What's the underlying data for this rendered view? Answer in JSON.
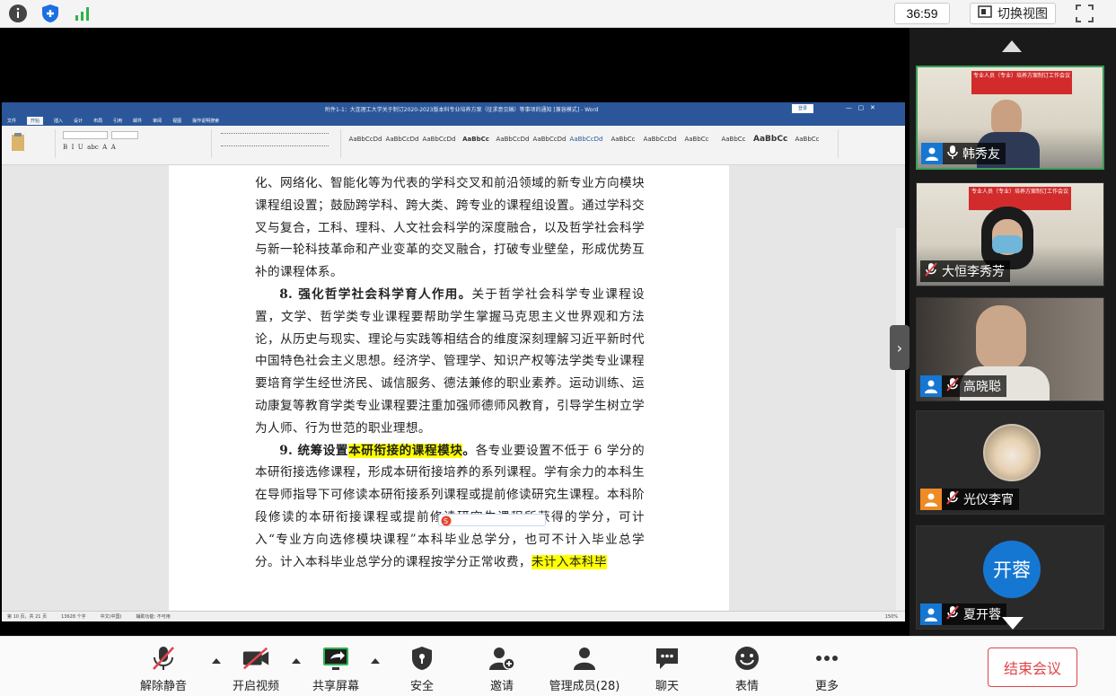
{
  "topbar": {
    "timer": "36:59",
    "switch_view": "切换视图"
  },
  "word": {
    "title": "附件1-1：大连理工大学关于制订2020-2023版本科专业培养方案（征求意见稿）等事项的通知 [兼容模式] - Word",
    "tabs": [
      "文件",
      "开始",
      "插入",
      "设计",
      "布局",
      "引用",
      "邮件",
      "审阅",
      "视图",
      "操作说明搜索"
    ],
    "styles": [
      "AaBbCcDd",
      "AaBbCcDd",
      "AaBbCcDd",
      "AaBbCc",
      "AaBbCcDd",
      "AaBbCcDd",
      "AaBbCcDd",
      "AaBbCc",
      "AaBbCcDd",
      "AaBbCc",
      "AaBbCc",
      "AaBbCc",
      "AaBbCc"
    ],
    "paragraphs": {
      "p7_lines": "化、网络化、智能化等为代表的学科交叉和前沿领域的新专业方向模块课程组设置；鼓励跨学科、跨大类、跨专业的课程组设置。通过学科交叉与复合，工科、理科、人文社会科学的深度融合，以及哲学社会科学与新一轮科技革命和产业变革的交叉融合，打破专业壁垒，形成优势互补的课程体系。",
      "p8_head": "8. 强化哲学社会科学育人作用。",
      "p8_body": "关于哲学社会科学专业课程设置，文学、哲学类专业课程要帮助学生掌握马克思主义世界观和方法论，从历史与现实、理论与实践等相结合的维度深刻理解习近平新时代中国特色社会主义思想。经济学、管理学、知识产权等法学类专业课程要培育学生经世济民、诚信服务、德法兼修的职业素养。运动训练、运动康复等教育学类专业课程要注重加强师德师风教育，引导学生树立学为人师、行为世范的职业理想。",
      "p9_head_a": "9. 统筹设置",
      "p9_head_hl": "本研衔接的课程模块",
      "p9_head_b": "。",
      "p9_body": "各专业要设置不低于 6 学分的本研衔接选修课程，形成本研衔接培养的系列课程。学有余力的本科生在导师指导下可修读本研衔接系列课程或提前修读研究生课程。本科阶段修读的本研衔接课程或提前修读研究生课程所获得的学分，可计入“专业方向选修模块课程”本科毕业总学分，也可不计入毕业总学分。计入本科毕业总学分的课程按学分正常收费，",
      "p9_tail_hl": "未计入本科毕"
    },
    "status": [
      "第 10 页，共 21 页",
      "13628 个字",
      "中文(中国)",
      "辅助功能: 不可用"
    ],
    "zoom": "150%"
  },
  "participants": [
    {
      "name": "韩秀友",
      "banner": "专业人员（专业）培养方案制订工作会议"
    },
    {
      "name": "大恒李秀芳",
      "banner": "专业人员（专业）培养方案制订工作会议"
    },
    {
      "name": "高晓聪"
    },
    {
      "name": "光仪李宵"
    },
    {
      "name": "夏开蓉",
      "avatar_text": "开蓉"
    }
  ],
  "toolbar": {
    "unmute": "解除静音",
    "video": "开启视频",
    "share": "共享屏幕",
    "security": "安全",
    "invite": "邀请",
    "members": "管理成员(28)",
    "chat": "聊天",
    "emoji": "表情",
    "more": "更多",
    "end": "结束会议"
  },
  "colors": {
    "word_blue": "#2b579a",
    "end_red": "#e0444a",
    "active_green": "#3b9c57",
    "avatar_blue": "#1677d2",
    "highlight": "#ffff00"
  }
}
